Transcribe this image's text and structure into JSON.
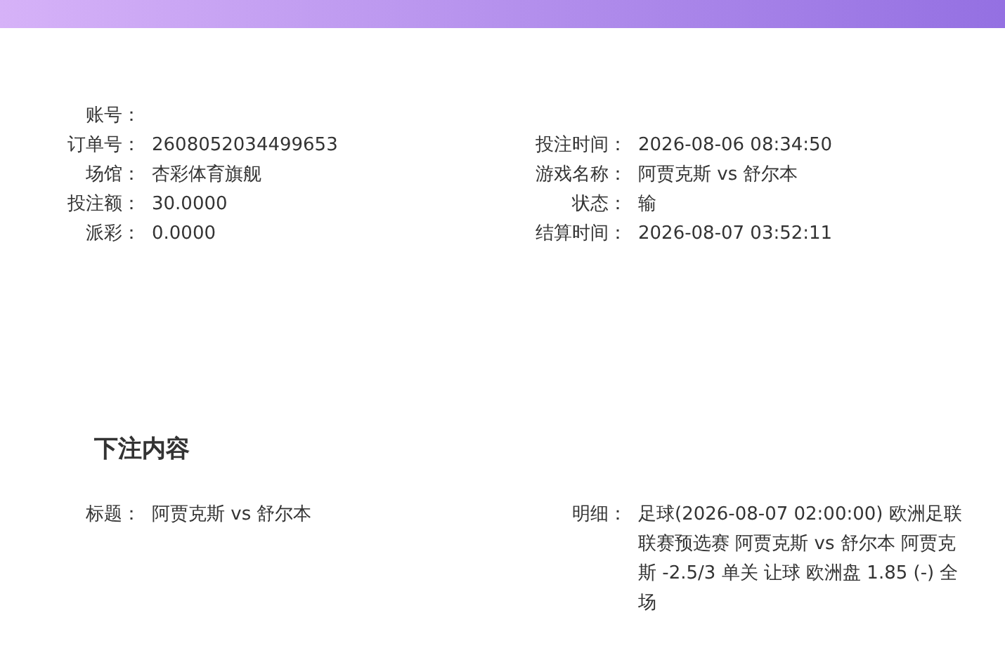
{
  "info": {
    "left": [
      {
        "label": "账号："
      },
      {
        "label": "订单号：",
        "value": "2608052034499653"
      },
      {
        "label": "场馆：",
        "value": "杏彩体育旗舰"
      },
      {
        "label": "投注额：",
        "value": "30.0000"
      },
      {
        "label": "派彩：",
        "value": "0.0000"
      }
    ],
    "right": [
      {
        "label": "投注时间：",
        "value": "2026-08-06 08:34:50"
      },
      {
        "label": "游戏名称：",
        "value": "阿贾克斯 vs 舒尔本"
      },
      {
        "label": "状态：",
        "value": "输"
      },
      {
        "label": "结算时间：",
        "value": "2026-08-07 03:52:11"
      }
    ]
  },
  "bet_content": {
    "heading": "下注内容",
    "title": {
      "label": "标题：",
      "value": "阿贾克斯 vs 舒尔本"
    },
    "detail": {
      "label": "明细：",
      "value": "足球(2026-08-07 02:00:00) 欧洲足联联赛预选赛 阿贾克斯 vs 舒尔本 阿贾克斯 -2.5/3 单关 让球 欧洲盘 1.85 (-) 全场"
    }
  }
}
